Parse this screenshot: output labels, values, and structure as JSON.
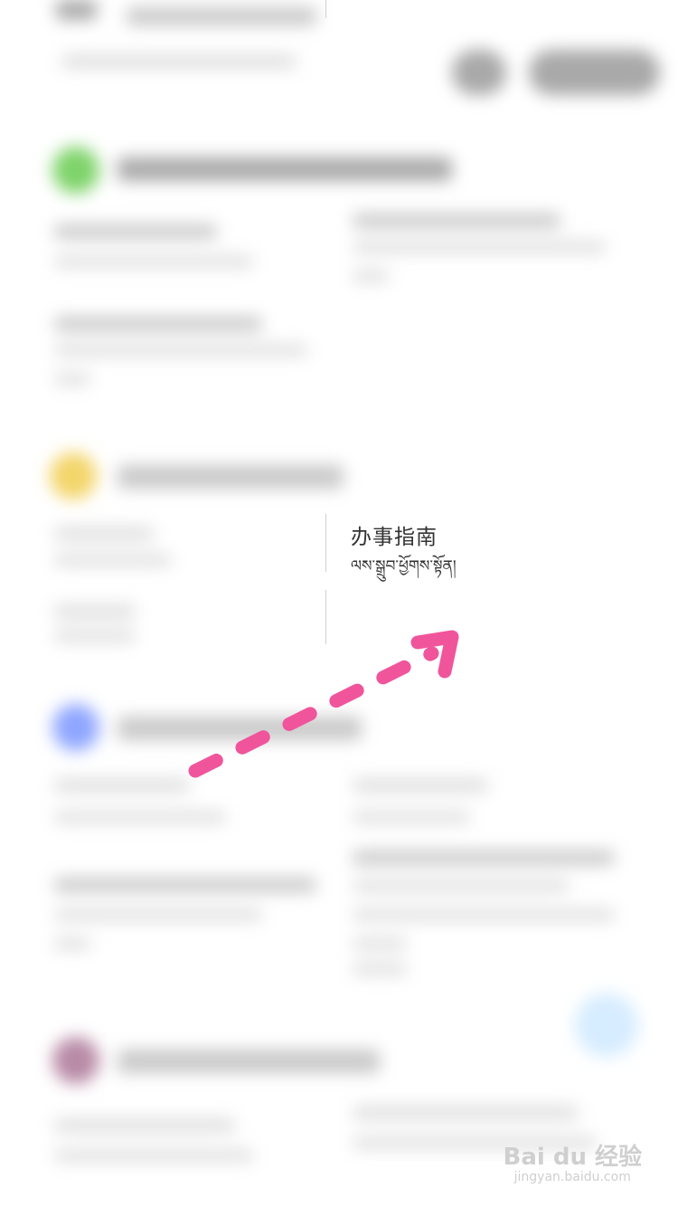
{
  "menu": {
    "title": "办事指南",
    "subtitle": "ལས་སྒྲུབ་ཕྱོགས་སྟོན།"
  },
  "section_colors": {
    "green": "#7ed36a",
    "yellow": "#f3d56a",
    "blue": "#8fa6ff",
    "purple": "#b88aa6",
    "fab": "#d6ecff"
  },
  "annotation": {
    "arrow_color": "#f0559b",
    "arrow_icon": "dashed-arrow-icon"
  },
  "watermark": {
    "logo": "Bai du 经验",
    "url": "jingyan.baidu.com"
  }
}
